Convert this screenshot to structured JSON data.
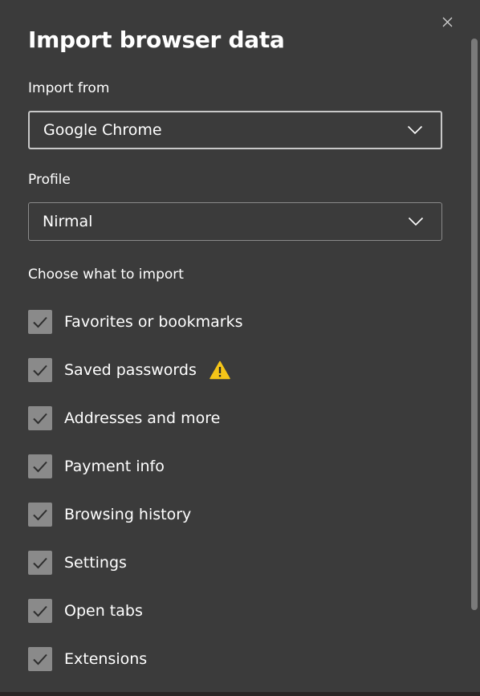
{
  "dialog": {
    "title": "Import browser data",
    "close_icon": "close-icon"
  },
  "import_from": {
    "label": "Import from",
    "value": "Google Chrome"
  },
  "profile": {
    "label": "Profile",
    "value": "Nirmal"
  },
  "choose": {
    "label": "Choose what to import",
    "items": [
      {
        "label": "Favorites or bookmarks",
        "checked": true
      },
      {
        "label": "Saved passwords",
        "checked": true,
        "icon": "warning-icon"
      },
      {
        "label": "Addresses and more",
        "checked": true
      },
      {
        "label": "Payment info",
        "checked": true
      },
      {
        "label": "Browsing history",
        "checked": true
      },
      {
        "label": "Settings",
        "checked": true
      },
      {
        "label": "Open tabs",
        "checked": true
      },
      {
        "label": "Extensions",
        "checked": true
      }
    ]
  },
  "colors": {
    "background": "#3b3b3b",
    "checkbox_fill": "#8a8a8a",
    "warning": "#f5c518"
  }
}
